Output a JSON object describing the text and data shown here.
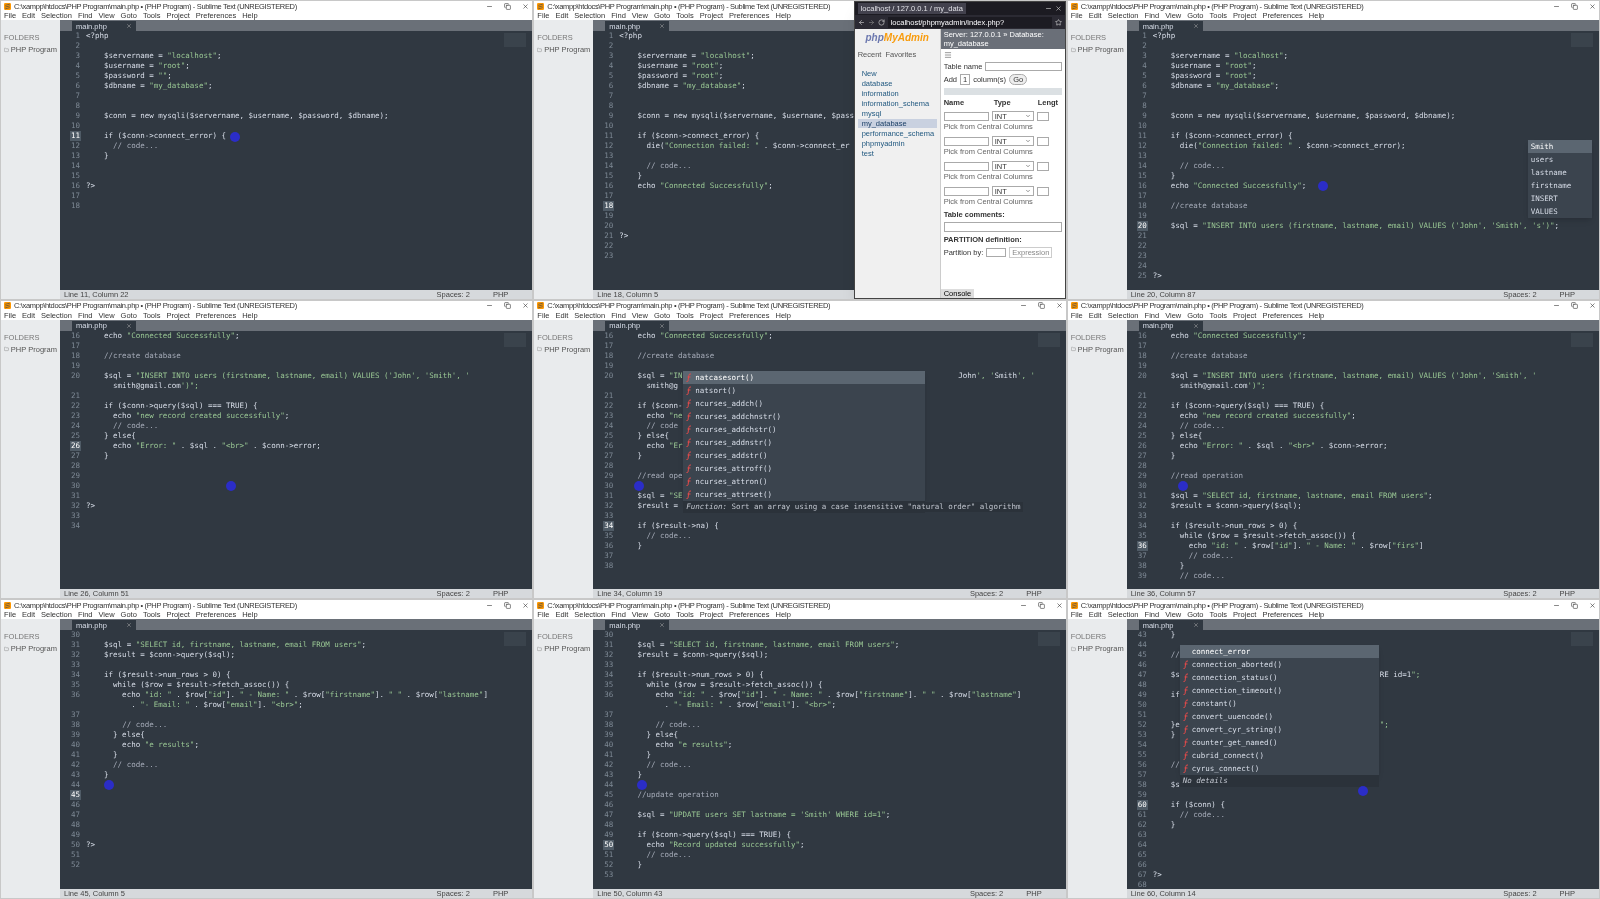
{
  "panels": [
    {
      "title": "C:\\xampp\\htdocs\\PHP Program\\main.php • (PHP Program) - Sublime Text (UNREGISTERED)",
      "menu": [
        "File",
        "Edit",
        "Selection",
        "Find",
        "View",
        "Goto",
        "Tools",
        "Project",
        "Preferences",
        "Help"
      ],
      "sidebar": {
        "heading": "FOLDERS",
        "folder": "PHP Program"
      },
      "tab": "main.php",
      "status": {
        "position": "Line 11, Column 22",
        "indent": "Spaces: 2",
        "syntax": "PHP"
      },
      "lines": [
        {
          "n": "1",
          "code": "<?php",
          "current": false
        },
        {
          "n": "2",
          "current": false
        },
        {
          "n": "3",
          "code": "    $servername = \"localhost\";",
          "current": false
        },
        {
          "n": "4",
          "code": "    $username = \"root\";",
          "current": false
        },
        {
          "n": "5",
          "code": "    $password = \"\";",
          "current": false
        },
        {
          "n": "6",
          "code": "    $dbname = \"my_database\";",
          "current": false
        },
        {
          "n": "7",
          "current": false
        },
        {
          "n": "8",
          "current": false
        },
        {
          "n": "9",
          "code": "    $conn = new mysqli($servername, $username, $password, $dbname);",
          "current": false
        },
        {
          "n": "10",
          "current": false
        },
        {
          "n": "11",
          "code": "    if ($conn->connect_error) {",
          "current": true
        },
        {
          "n": "12",
          "code": "      // code...",
          "current": false
        },
        {
          "n": "13",
          "code": "    }",
          "current": false
        },
        {
          "n": "14",
          "current": false
        },
        {
          "n": "15",
          "current": false
        },
        {
          "n": "16",
          "code": "?>",
          "current": false
        },
        {
          "n": "17",
          "current": false
        },
        {
          "n": "18",
          "current": false
        }
      ]
    },
    {
      "title": "C:\\xampp\\htdocs\\PHP Program\\main.php • (PHP Program) - Sublime Text (UNREGISTERED)",
      "menu": [
        "File",
        "Edit",
        "Selection",
        "Find",
        "View",
        "Goto",
        "Tools",
        "Project",
        "Preferences",
        "Help"
      ],
      "sidebar": {
        "heading": "FOLDERS",
        "folder": "PHP Program"
      },
      "tab": "main.php",
      "status": {
        "position": "Line 18, Column 5"
      },
      "lines": [
        {
          "n": "1",
          "code": "<?php",
          "current": false
        },
        {
          "n": "2",
          "current": false
        },
        {
          "n": "3",
          "code": "    $servername = \"localhost\";",
          "current": false
        },
        {
          "n": "4",
          "code": "    $username = \"root\";",
          "current": false
        },
        {
          "n": "5",
          "code": "    $password = \"root\";",
          "current": false
        },
        {
          "n": "6",
          "code": "    $dbname = \"my_database\";",
          "current": false
        },
        {
          "n": "7",
          "current": false
        },
        {
          "n": "8",
          "current": false
        },
        {
          "n": "9",
          "code": "    $conn = new mysqli($servername, $username, $pass",
          "current": false
        },
        {
          "n": "10",
          "current": false
        },
        {
          "n": "11",
          "code": "    if ($conn->connect_error) {",
          "current": false
        },
        {
          "n": "12",
          "code": "      die(\"Connection failed: \" . $conn->connect_er",
          "current": false
        },
        {
          "n": "13",
          "current": false
        },
        {
          "n": "14",
          "code": "      // code...",
          "current": false
        },
        {
          "n": "15",
          "code": "    }",
          "current": false
        },
        {
          "n": "16",
          "code": "    echo \"Connected Successfully\";",
          "current": false
        },
        {
          "n": "17",
          "current": false
        },
        {
          "n": "18",
          "current": true
        },
        {
          "n": "19",
          "current": false
        },
        {
          "n": "20",
          "current": false
        },
        {
          "n": "21",
          "code": "?>",
          "current": false
        },
        {
          "n": "22",
          "current": false
        },
        {
          "n": "23",
          "current": false
        }
      ],
      "browser": {
        "tab": "localhost / 127.0.0.1 / my_data",
        "address": "localhost/phpmyadmin/index.php?",
        "logo_a": "php",
        "logo_b": "MyAdmin",
        "nav_tabs": [
          "Recent",
          "Favorites"
        ],
        "tree": [
          {
            "label": "New",
            "selected": false
          },
          {
            "label": "database",
            "selected": false
          },
          {
            "label": "information",
            "selected": false
          },
          {
            "label": "information_schema",
            "selected": false
          },
          {
            "label": "mysql",
            "selected": false
          },
          {
            "label": "my_database",
            "selected": true
          },
          {
            "label": "performance_schema",
            "selected": false
          },
          {
            "label": "phpmyadmin",
            "selected": false
          },
          {
            "label": "test",
            "selected": false
          }
        ],
        "breadcrumb": "Server: 127.0.0.1 » Database: my_database",
        "table_name_label": "Table name",
        "add_label": "Add",
        "add_count": "1",
        "columns_label": "column(s)",
        "go": "Go",
        "headers": [
          "Name",
          "Type",
          "Lengt"
        ],
        "rows": [
          {
            "type": "INT",
            "hint": "Pick from Central Columns"
          },
          {
            "type": "INT",
            "hint": "Pick from Central Columns"
          },
          {
            "type": "INT",
            "hint": "Pick from Central Columns"
          },
          {
            "type": "INT",
            "hint": "Pick from Central Columns"
          }
        ],
        "comments_label": "Table comments:",
        "partition_label": "PARTITION definition:",
        "partition_by": "Partition by:",
        "expression": "Expression",
        "console": "Console"
      }
    },
    {
      "title": "C:\\xampp\\htdocs\\PHP Program\\main.php • (PHP Program) - Sublime Text (UNREGISTERED)",
      "menu": [
        "File",
        "Edit",
        "Selection",
        "Find",
        "View",
        "Goto",
        "Tools",
        "Project",
        "Preferences",
        "Help"
      ],
      "sidebar": {
        "heading": "FOLDERS",
        "folder": "PHP Program"
      },
      "tab": "main.php",
      "status": {
        "position": "Line 20, Column 87",
        "indent": "Spaces: 2",
        "syntax": "PHP"
      },
      "lines": [
        {
          "n": "1",
          "code": "<?php",
          "current": false
        },
        {
          "n": "2",
          "current": false
        },
        {
          "n": "3",
          "code": "    $servername = \"localhost\";",
          "current": false
        },
        {
          "n": "4",
          "code": "    $username = \"root\";",
          "current": false
        },
        {
          "n": "5",
          "code": "    $password = \"root\";",
          "current": false
        },
        {
          "n": "6",
          "code": "    $dbname = \"my_database\";",
          "current": false
        },
        {
          "n": "7",
          "current": false
        },
        {
          "n": "8",
          "current": false
        },
        {
          "n": "9",
          "code": "    $conn = new mysqli($servername, $username, $password, $dbname);",
          "current": false
        },
        {
          "n": "10",
          "current": false
        },
        {
          "n": "11",
          "code": "    if ($conn->connect_error) {",
          "current": false
        },
        {
          "n": "12",
          "code": "      die(\"Connection failed: \" . $conn->connect_error);",
          "current": false
        },
        {
          "n": "13",
          "current": false
        },
        {
          "n": "14",
          "code": "      // code...",
          "current": false
        },
        {
          "n": "15",
          "code": "    }",
          "current": false
        },
        {
          "n": "16",
          "code": "    echo \"Connected Successfully\";",
          "current": false
        },
        {
          "n": "17",
          "current": false
        },
        {
          "n": "18",
          "code": "    //create database",
          "current": false
        },
        {
          "n": "19",
          "current": false
        },
        {
          "n": "20",
          "code": "    $sql = \"INSERT INTO users (firstname, lastname, email) VALUES ('John', 'Smith', 's')\";",
          "current": true
        },
        {
          "n": "21",
          "current": false
        },
        {
          "n": "22",
          "current": false
        },
        {
          "n": "23",
          "current": false
        },
        {
          "n": "24",
          "current": false
        },
        {
          "n": "25",
          "code": "?>",
          "current": false
        }
      ],
      "popup": {
        "items": [
          {
            "label": "Smith",
            "kind": "word",
            "selected": true
          },
          {
            "label": "users",
            "kind": "word",
            "selected": false
          },
          {
            "label": "lastname",
            "kind": "word",
            "selected": false
          },
          {
            "label": "firstname",
            "kind": "word",
            "selected": false
          },
          {
            "label": "INSERT",
            "kind": "word",
            "selected": false
          },
          {
            "label": "VALUES",
            "kind": "word",
            "selected": false
          }
        ]
      }
    },
    {
      "title": "C:\\xampp\\htdocs\\PHP Program\\main.php • (PHP Program) - Sublime Text (UNREGISTERED)",
      "menu": [
        "File",
        "Edit",
        "Selection",
        "Find",
        "View",
        "Goto",
        "Tools",
        "Project",
        "Preferences",
        "Help"
      ],
      "sidebar": {
        "heading": "FOLDERS",
        "folder": "PHP Program"
      },
      "tab": "main.php",
      "status": {
        "position": "Line 26, Column 51",
        "indent": "Spaces: 2",
        "syntax": "PHP"
      },
      "lines": [
        {
          "n": "16",
          "code": "    echo \"Connected Successfully\";",
          "current": false
        },
        {
          "n": "17",
          "current": false
        },
        {
          "n": "18",
          "code": "    //create database",
          "current": false
        },
        {
          "n": "19",
          "current": false
        },
        {
          "n": "20",
          "code": "    $sql = \"INSERT INTO users (firstname, lastname, email) VALUES ('John', 'Smith', '",
          "current": false
        },
        {
          "code": "      smith@gmail.com')\";"
        },
        {
          "n": "21",
          "current": false
        },
        {
          "n": "22",
          "code": "    if ($conn->query($sql) === TRUE) {",
          "current": false
        },
        {
          "n": "23",
          "code": "      echo \"new record created successfully\";",
          "current": false
        },
        {
          "n": "24",
          "code": "      // code...",
          "current": false
        },
        {
          "n": "25",
          "code": "    } else{",
          "current": false
        },
        {
          "n": "26",
          "code": "      echo \"Error: \" . $sql . \"<br>\" . $conn->error;",
          "current": true
        },
        {
          "n": "27",
          "code": "    }",
          "current": false
        },
        {
          "n": "28",
          "current": false
        },
        {
          "n": "29",
          "current": false
        },
        {
          "n": "30",
          "current": false
        },
        {
          "n": "31",
          "current": false
        },
        {
          "n": "32",
          "code": "?>",
          "current": false
        },
        {
          "n": "33",
          "current": false
        },
        {
          "n": "34",
          "current": false
        }
      ]
    },
    {
      "title": "C:\\xampp\\htdocs\\PHP Program\\main.php • (PHP Program) - Sublime Text (UNREGISTERED)",
      "menu": [
        "File",
        "Edit",
        "Selection",
        "Find",
        "View",
        "Goto",
        "Tools",
        "Project",
        "Preferences",
        "Help"
      ],
      "sidebar": {
        "heading": "FOLDERS",
        "folder": "PHP Program"
      },
      "tab": "main.php",
      "status": {
        "position": "Line 34, Column 19",
        "indent": "Spaces: 2",
        "syntax": "PHP"
      },
      "lines": [
        {
          "n": "16",
          "code": "    echo \"Connected Successfully\";",
          "current": false
        },
        {
          "n": "17",
          "current": false
        },
        {
          "n": "18",
          "code": "    //create database",
          "current": false
        },
        {
          "n": "19",
          "current": false
        },
        {
          "n": "20",
          "code": "    $sql = \"IN",
          "tail": "John', 'Smith', '",
          "current": false
        },
        {
          "code": "      smith@g"
        },
        {
          "n": "21",
          "current": false
        },
        {
          "n": "22",
          "code": "    if ($conn-",
          "current": false
        },
        {
          "n": "23",
          "code": "      echo \"ne",
          "current": false
        },
        {
          "n": "24",
          "code": "      // code",
          "current": false
        },
        {
          "n": "25",
          "code": "    } else{",
          "current": false
        },
        {
          "n": "26",
          "code": "      echo \"Er",
          "current": false
        },
        {
          "n": "27",
          "code": "    }",
          "current": false
        },
        {
          "n": "28",
          "current": false
        },
        {
          "n": "29",
          "code": "    //read ope",
          "current": false
        },
        {
          "n": "30",
          "current": false
        },
        {
          "n": "31",
          "code": "    $sql = \"SE",
          "current": false
        },
        {
          "n": "32",
          "code": "    $result =",
          "current": false
        },
        {
          "n": "33",
          "current": false
        },
        {
          "n": "34",
          "code": "    if ($result->na) {",
          "current": true
        },
        {
          "n": "35",
          "code": "      // code...",
          "current": false
        },
        {
          "n": "36",
          "code": "    }",
          "current": false
        },
        {
          "n": "37",
          "current": false
        },
        {
          "n": "38",
          "current": false
        }
      ],
      "popup": {
        "items": [
          {
            "label": "natcasesort()",
            "kind": "function",
            "selected": true
          },
          {
            "label": "natsort()",
            "kind": "function",
            "selected": false
          },
          {
            "label": "ncurses_addch()",
            "kind": "function",
            "selected": false
          },
          {
            "label": "ncurses_addchnstr()",
            "kind": "function",
            "selected": false
          },
          {
            "label": "ncurses_addchstr()",
            "kind": "function",
            "selected": false
          },
          {
            "label": "ncurses_addnstr()",
            "kind": "function",
            "selected": false
          },
          {
            "label": "ncurses_addstr()",
            "kind": "function",
            "selected": false
          },
          {
            "label": "ncurses_attroff()",
            "kind": "function",
            "selected": false
          },
          {
            "label": "ncurses_attron()",
            "kind": "function",
            "selected": false
          },
          {
            "label": "ncurses_attrset()",
            "kind": "function",
            "selected": false
          }
        ],
        "footer": "*Function:* Sort an array using a case insensitive \"natural order\" algorithm"
      }
    },
    {
      "title": "C:\\xampp\\htdocs\\PHP Program\\main.php • (PHP Program) - Sublime Text (UNREGISTERED)",
      "menu": [
        "File",
        "Edit",
        "Selection",
        "Find",
        "View",
        "Goto",
        "Tools",
        "Project",
        "Preferences",
        "Help"
      ],
      "sidebar": {
        "heading": "FOLDERS",
        "folder": "PHP Program"
      },
      "tab": "main.php",
      "status": {
        "position": "Line 36, Column 57",
        "indent": "Spaces: 2",
        "syntax": "PHP"
      },
      "lines": [
        {
          "n": "16",
          "code": "    echo \"Connected Successfully\";",
          "current": false
        },
        {
          "n": "17",
          "current": false
        },
        {
          "n": "18",
          "code": "    //create database",
          "current": false
        },
        {
          "n": "19",
          "current": false
        },
        {
          "n": "20",
          "code": "    $sql = \"INSERT INTO users (firstname, lastname, email) VALUES ('John', 'Smith', '",
          "current": false
        },
        {
          "code": "      smith@gmail.com')\";"
        },
        {
          "n": "21",
          "current": false
        },
        {
          "n": "22",
          "code": "    if ($conn->query($sql) === TRUE) {",
          "current": false
        },
        {
          "n": "23",
          "code": "      echo \"new record created successfully\";",
          "current": false
        },
        {
          "n": "24",
          "code": "      // code...",
          "current": false
        },
        {
          "n": "25",
          "code": "    } else{",
          "current": false
        },
        {
          "n": "26",
          "code": "      echo \"Error: \" . $sql . \"<br>\" . $conn->error;",
          "current": false
        },
        {
          "n": "27",
          "code": "    }",
          "current": false
        },
        {
          "n": "28",
          "current": false
        },
        {
          "n": "29",
          "code": "    //read operation",
          "current": false
        },
        {
          "n": "30",
          "current": false
        },
        {
          "n": "31",
          "code": "    $sql = \"SELECT id, firstname, lastname, email FROM users\";",
          "current": false
        },
        {
          "n": "32",
          "code": "    $result = $conn->query($sql);",
          "current": false
        },
        {
          "n": "33",
          "current": false
        },
        {
          "n": "34",
          "code": "    if ($result->num_rows > 0) {",
          "current": false
        },
        {
          "n": "35",
          "code": "      while ($row = $result->fetch_assoc()) {",
          "current": false
        },
        {
          "n": "36",
          "code": "        echo \"id: \" . $row[\"id\"]. \" - Name: \" . $row[\"firs\"]",
          "current": true
        },
        {
          "n": "37",
          "code": "        // code...",
          "current": false
        },
        {
          "n": "38",
          "code": "      }",
          "current": false
        },
        {
          "n": "39",
          "code": "      // code...",
          "current": false
        }
      ]
    },
    {
      "title": "C:\\xampp\\htdocs\\PHP Program\\main.php • (PHP Program) - Sublime Text (UNREGISTERED)",
      "menu": [
        "File",
        "Edit",
        "Selection",
        "Find",
        "View",
        "Goto",
        "Tools",
        "Project",
        "Preferences",
        "Help"
      ],
      "sidebar": {
        "heading": "FOLDERS",
        "folder": "PHP Program"
      },
      "tab": "main.php",
      "status": {
        "position": "Line 45, Column 5",
        "indent": "Spaces: 2",
        "syntax": "PHP"
      },
      "lines": [
        {
          "n": "30",
          "current": false
        },
        {
          "n": "31",
          "code": "    $sql = \"SELECT id, firstname, lastname, email FROM users\";",
          "current": false
        },
        {
          "n": "32",
          "code": "    $result = $conn->query($sql);",
          "current": false
        },
        {
          "n": "33",
          "current": false
        },
        {
          "n": "34",
          "code": "    if ($result->num_rows > 0) {",
          "current": false
        },
        {
          "n": "35",
          "code": "      while ($row = $result->fetch_assoc()) {",
          "current": false
        },
        {
          "n": "36",
          "code": "        echo \"id: \" . $row[\"id\"]. \" - Name: \" . $row[\"firstname\"]. \" \" . $row[\"lastname\"]",
          "current": false
        },
        {
          "code": "          . \"- Email: \" . $row[\"email\"]. \"<br>\";"
        },
        {
          "n": "37",
          "current": false
        },
        {
          "n": "38",
          "code": "        // code...",
          "current": false
        },
        {
          "n": "39",
          "code": "      } else{",
          "current": false
        },
        {
          "n": "40",
          "code": "        echo \"e results\";",
          "current": false
        },
        {
          "n": "41",
          "code": "      }",
          "current": false
        },
        {
          "n": "42",
          "code": "      // code...",
          "current": false
        },
        {
          "n": "43",
          "code": "    }",
          "current": false
        },
        {
          "n": "44",
          "current": false
        },
        {
          "n": "45",
          "current": true
        },
        {
          "n": "46",
          "current": false
        },
        {
          "n": "47",
          "current": false
        },
        {
          "n": "48",
          "current": false
        },
        {
          "n": "49",
          "current": false
        },
        {
          "n": "50",
          "code": "?>",
          "current": false
        },
        {
          "n": "51",
          "current": false
        },
        {
          "n": "52",
          "current": false
        }
      ]
    },
    {
      "title": "C:\\xampp\\htdocs\\PHP Program\\main.php • (PHP Program) - Sublime Text (UNREGISTERED)",
      "menu": [
        "File",
        "Edit",
        "Selection",
        "Find",
        "View",
        "Goto",
        "Tools",
        "Project",
        "Preferences",
        "Help"
      ],
      "sidebar": {
        "heading": "FOLDERS",
        "folder": "PHP Program"
      },
      "tab": "main.php",
      "status": {
        "position": "Line 50, Column 43",
        "indent": "Spaces: 2",
        "syntax": "PHP"
      },
      "lines": [
        {
          "n": "30",
          "current": false
        },
        {
          "n": "31",
          "code": "    $sql = \"SELECT id, firstname, lastname, email FROM users\";",
          "current": false
        },
        {
          "n": "32",
          "code": "    $result = $conn->query($sql);",
          "current": false
        },
        {
          "n": "33",
          "current": false
        },
        {
          "n": "34",
          "code": "    if ($result->num_rows > 0) {",
          "current": false
        },
        {
          "n": "35",
          "code": "      while ($row = $result->fetch_assoc()) {",
          "current": false
        },
        {
          "n": "36",
          "code": "        echo \"id: \" . $row[\"id\"]. \" - Name: \" . $row[\"firstname\"]. \" \" . $row[\"lastname\"]",
          "current": false
        },
        {
          "code": "          . \"- Email: \" . $row[\"email\"]. \"<br>\";"
        },
        {
          "n": "37",
          "current": false
        },
        {
          "n": "38",
          "code": "        // code...",
          "current": false
        },
        {
          "n": "39",
          "code": "      } else{",
          "current": false
        },
        {
          "n": "40",
          "code": "        echo \"e results\";",
          "current": false
        },
        {
          "n": "41",
          "code": "      }",
          "current": false
        },
        {
          "n": "42",
          "code": "      // code...",
          "current": false
        },
        {
          "n": "43",
          "code": "    }",
          "current": false
        },
        {
          "n": "44",
          "current": false
        },
        {
          "n": "45",
          "code": "    //update operation",
          "current": false
        },
        {
          "n": "46",
          "current": false
        },
        {
          "n": "47",
          "code": "    $sql = \"UPDATE users SET lastname = 'Smith' WHERE id=1\";",
          "current": false
        },
        {
          "n": "48",
          "current": false
        },
        {
          "n": "49",
          "code": "    if ($conn->query($sql) === TRUE) {",
          "current": false
        },
        {
          "n": "50",
          "code": "      echo \"Record updated successfully\";",
          "current": true
        },
        {
          "n": "51",
          "code": "      // code...",
          "current": false
        },
        {
          "n": "52",
          "code": "    }",
          "current": false
        },
        {
          "n": "53",
          "current": false
        }
      ]
    },
    {
      "title": "C:\\xampp\\htdocs\\PHP Program\\main.php • (PHP Program) - Sublime Text (UNREGISTERED)",
      "menu": [
        "File",
        "Edit",
        "Selection",
        "Find",
        "View",
        "Goto",
        "Tools",
        "Project",
        "Preferences",
        "Help"
      ],
      "sidebar": {
        "heading": "FOLDERS",
        "folder": "PHP Program"
      },
      "tab": "main.php",
      "status": {
        "position": "Line 60, Column 14",
        "indent": "Spaces: 2",
        "syntax": "PHP"
      },
      "lines": [
        {
          "n": "43",
          "code": "    }",
          "current": false
        },
        {
          "n": "44",
          "current": false
        },
        {
          "n": "45",
          "code": "    //",
          "current": false
        },
        {
          "n": "46",
          "current": false
        },
        {
          "n": "47",
          "code": "    $s",
          "tail": "RE id=1\";",
          "current": false
        },
        {
          "n": "48",
          "current": false
        },
        {
          "n": "49",
          "code": "    if",
          "current": false
        },
        {
          "n": "50",
          "current": false
        },
        {
          "n": "51",
          "current": false
        },
        {
          "n": "52",
          "code": "    }e",
          "tail": "\";",
          "current": false
        },
        {
          "n": "53",
          "code": "    }",
          "current": false
        },
        {
          "n": "54",
          "current": false
        },
        {
          "n": "55",
          "current": false
        },
        {
          "n": "56",
          "code": "    //",
          "current": false
        },
        {
          "n": "57",
          "current": false
        },
        {
          "n": "58",
          "code": "    $s",
          "current": false
        },
        {
          "n": "59",
          "current": false
        },
        {
          "n": "60",
          "code": "    if ($conn) {",
          "current": true
        },
        {
          "n": "61",
          "code": "      // code...",
          "current": false
        },
        {
          "n": "62",
          "code": "    }",
          "current": false
        },
        {
          "n": "63",
          "current": false
        },
        {
          "n": "64",
          "current": false
        },
        {
          "n": "65",
          "current": false
        },
        {
          "n": "66",
          "current": false
        },
        {
          "n": "67",
          "code": "?>",
          "current": false
        },
        {
          "n": "68",
          "current": false
        }
      ],
      "popup": {
        "items": [
          {
            "label": "connect_error",
            "kind": "property",
            "selected": true
          },
          {
            "label": "connection_aborted()",
            "kind": "function",
            "selected": false
          },
          {
            "label": "connection_status()",
            "kind": "function",
            "selected": false
          },
          {
            "label": "connection_timeout()",
            "kind": "function",
            "selected": false
          },
          {
            "label": "constant()",
            "kind": "function",
            "selected": false
          },
          {
            "label": "convert_uuencode()",
            "kind": "function",
            "selected": false
          },
          {
            "label": "convert_cyr_string()",
            "kind": "function",
            "selected": false
          },
          {
            "label": "counter_get_named()",
            "kind": "function",
            "selected": false
          },
          {
            "label": "cubrid_connect()",
            "kind": "function",
            "selected": false
          },
          {
            "label": "cyrus_connect()",
            "kind": "function",
            "selected": false
          }
        ],
        "footer": "*No details*"
      }
    }
  ]
}
